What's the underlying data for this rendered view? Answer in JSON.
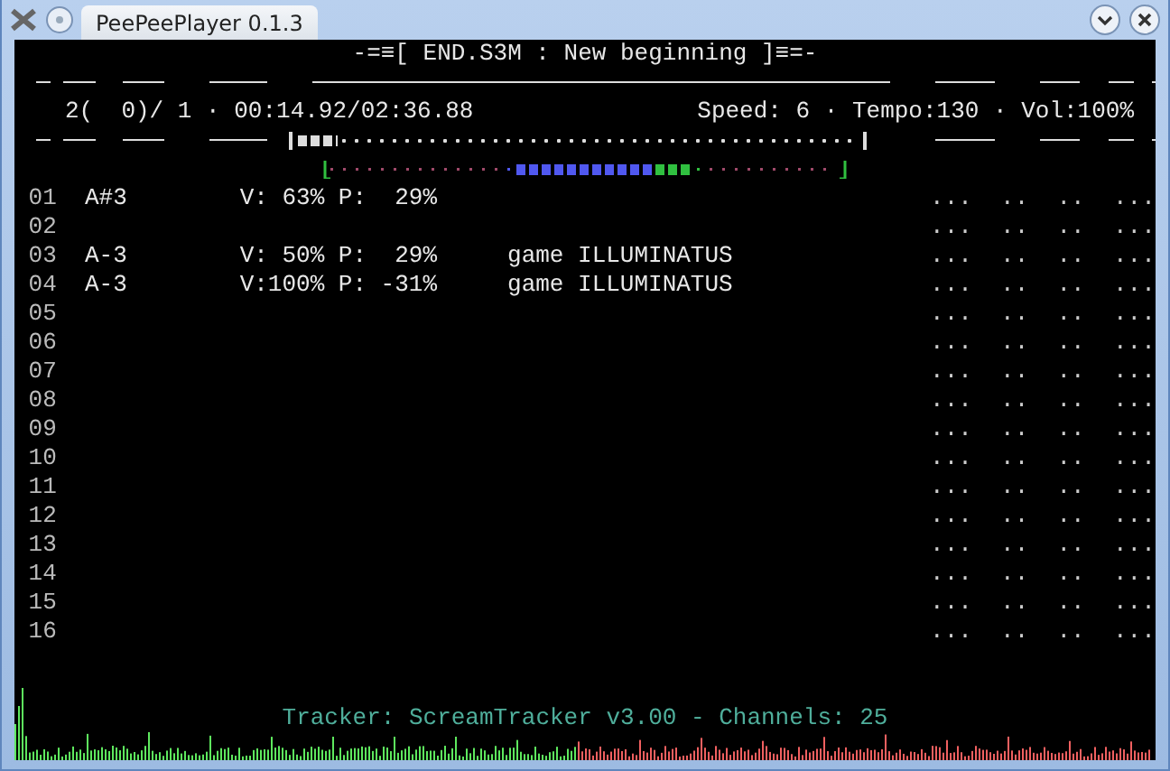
{
  "window": {
    "title": "PeePeePlayer 0.1.3"
  },
  "header": "-=≡[ END.S3M : New beginning ]≡=-",
  "position": "2(  0)/ 1 · 00:14.92/02:36.88",
  "status": "Speed: 6 · Tempo:130 · Vol:100%",
  "progress": {
    "level": 0.07
  },
  "channels": [
    {
      "number": "01",
      "note": "A#3",
      "volume": "V: 63%",
      "panning": "P:  29%",
      "pattern": "...  ..  ..  ..."
    },
    {
      "number": "02",
      "pattern": "...  ..  ..  ..."
    },
    {
      "number": "03",
      "note": "A-3",
      "volume": "V: 50%",
      "panning": "P:  29%",
      "instrument": "game ILLUMINATUS",
      "pattern": "...  ..  ..  ..."
    },
    {
      "number": "04",
      "note": "A-3",
      "volume": "V:100%",
      "panning": "P: -31%",
      "instrument": "game ILLUMINATUS",
      "pattern": "...  ..  ..  ..."
    },
    {
      "number": "05",
      "pattern": "...  ..  ..  ..."
    },
    {
      "number": "06",
      "pattern": "...  ..  ..  ..."
    },
    {
      "number": "07",
      "pattern": "...  ..  ..  ..."
    },
    {
      "number": "08",
      "pattern": "...  ..  ..  ..."
    },
    {
      "number": "09",
      "pattern": "...  ..  ..  ..."
    },
    {
      "number": "10",
      "pattern": "...  ..  ..  ..."
    },
    {
      "number": "11",
      "pattern": "...  ..  ..  ..."
    },
    {
      "number": "12",
      "pattern": "...  ..  ..  ..."
    },
    {
      "number": "13",
      "pattern": "...  ..  ..  ..."
    },
    {
      "number": "14",
      "pattern": "...  ..  ..  ..."
    },
    {
      "number": "15",
      "pattern": "...  ..  ..  ..."
    },
    {
      "number": "16",
      "pattern": "...  ..  ..  ..."
    }
  ],
  "footer": "Tracker: ScreamTracker v3.00 - Channels: 25"
}
